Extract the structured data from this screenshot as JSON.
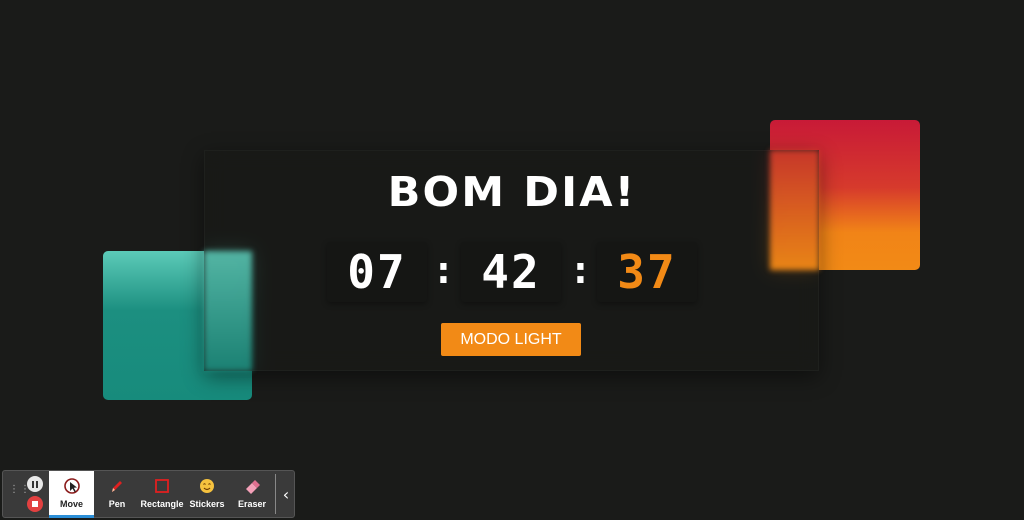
{
  "greeting": "BOM DIA!",
  "clock": {
    "hours": "07",
    "minutes": "42",
    "seconds": "37",
    "separator": ":"
  },
  "mode_button": "MODO LIGHT",
  "colors": {
    "background": "#1a1b19",
    "accent": "#f28a16",
    "teal": "#1c8f80",
    "red": "#c81a37"
  },
  "toolbar": {
    "grip_icon": "drag-handle-icon",
    "pause_icon": "pause-icon",
    "stop_icon": "stop-icon",
    "tools": [
      {
        "label": "Move",
        "icon": "cursor-icon",
        "active": true
      },
      {
        "label": "Pen",
        "icon": "pen-icon"
      },
      {
        "label": "Rectangle",
        "icon": "rectangle-icon"
      },
      {
        "label": "Stickers",
        "icon": "sticker-icon"
      },
      {
        "label": "Eraser",
        "icon": "eraser-icon"
      }
    ],
    "collapse_icon": "chevron-left-icon"
  }
}
